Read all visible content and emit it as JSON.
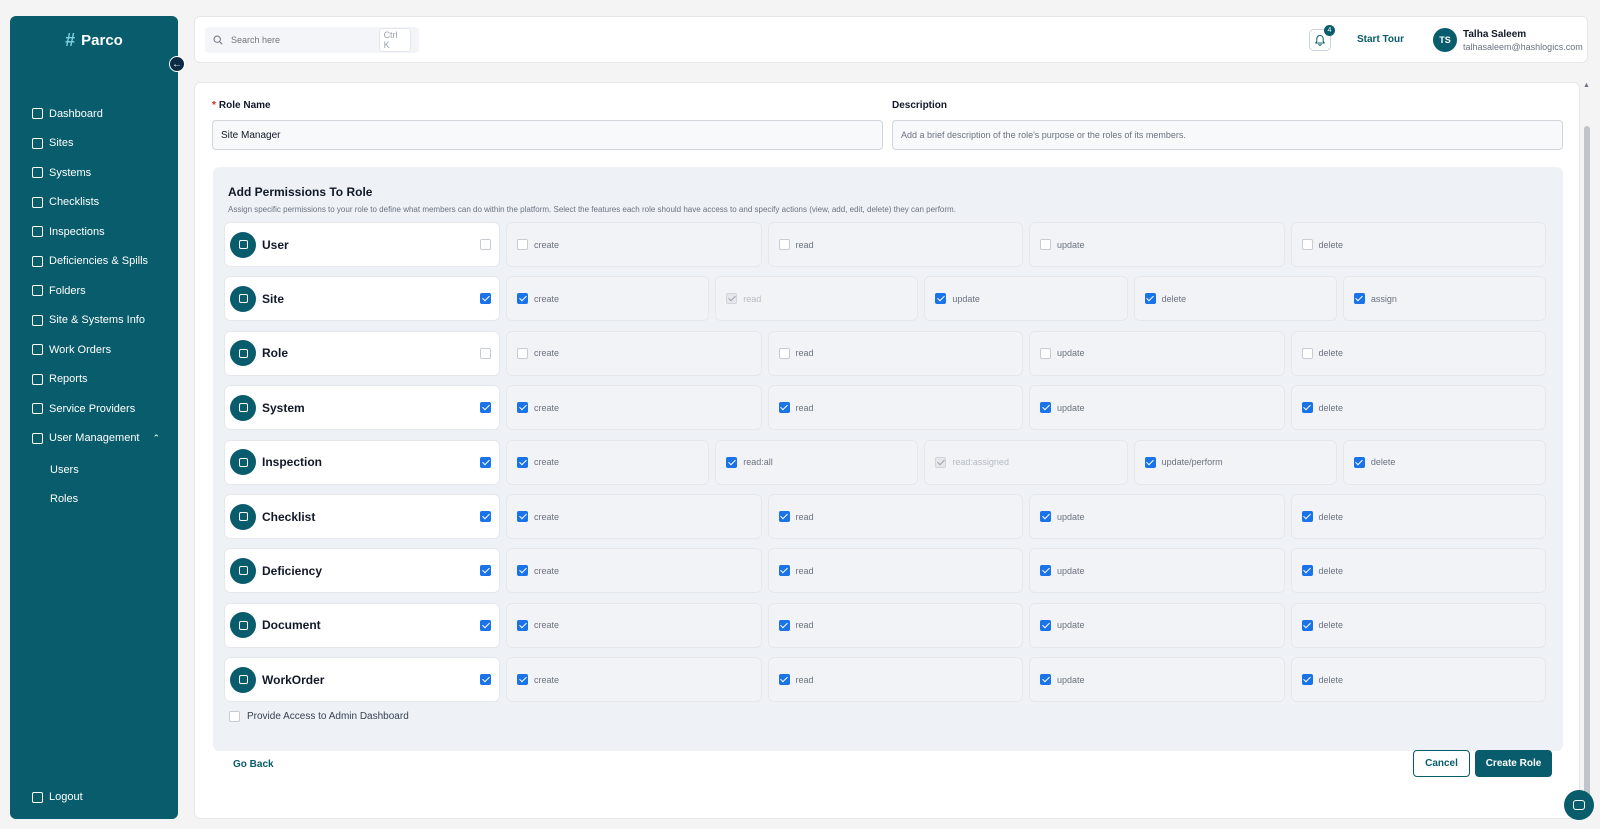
{
  "app": {
    "name": "Parco",
    "logo_glyph": "#"
  },
  "sidebar": {
    "items": [
      {
        "label": "Dashboard",
        "icon": "dashboard-icon"
      },
      {
        "label": "Sites",
        "icon": "building-icon"
      },
      {
        "label": "Systems",
        "icon": "box-icon"
      },
      {
        "label": "Checklists",
        "icon": "checklist-icon"
      },
      {
        "label": "Inspections",
        "icon": "inspection-icon"
      },
      {
        "label": "Deficiencies & Spills",
        "icon": "flag-icon"
      },
      {
        "label": "Folders",
        "icon": "folder-icon"
      },
      {
        "label": "Site & Systems Info",
        "icon": "document-icon"
      },
      {
        "label": "Work Orders",
        "icon": "clipboard-icon"
      },
      {
        "label": "Reports",
        "icon": "report-icon"
      },
      {
        "label": "Service Providers",
        "icon": "provider-icon"
      },
      {
        "label": "User Management",
        "icon": "user-icon",
        "chevron": "⌃"
      }
    ],
    "subitems": [
      {
        "label": "Users"
      },
      {
        "label": "Roles"
      }
    ],
    "logout": "Logout",
    "collapse_glyph": "←"
  },
  "header": {
    "search_placeholder": "Search here",
    "search_shortcut": "Ctrl K",
    "notification_count": "4",
    "start_tour": "Start Tour",
    "user": {
      "initials": "TS",
      "name": "Talha Saleem",
      "email": "talhasaleem@hashlogics.com"
    }
  },
  "form": {
    "role_name_required_mark": "*",
    "role_name_label": "Role Name",
    "role_name_value": "Site Manager",
    "description_label": "Description",
    "description_placeholder": "Add a brief description of the role's purpose or the roles of its members.",
    "permissions_title": "Add Permissions To Role",
    "permissions_subtitle": "Assign specific permissions to your role to define what members can do within the platform. Select the features each role should have access to and specify actions (view, add, edit, delete) they can perform.",
    "admin_access_label": "Provide Access to Admin Dashboard",
    "admin_access_checked": false,
    "go_back": "Go Back",
    "cancel": "Cancel",
    "create_role": "Create Role"
  },
  "permissions": [
    {
      "name": "User",
      "checked": false,
      "actions": [
        {
          "label": "create",
          "state": "off"
        },
        {
          "label": "read",
          "state": "off"
        },
        {
          "label": "update",
          "state": "off"
        },
        {
          "label": "delete",
          "state": "off"
        }
      ]
    },
    {
      "name": "Site",
      "checked": true,
      "actions": [
        {
          "label": "create",
          "state": "on"
        },
        {
          "label": "read",
          "state": "disabled"
        },
        {
          "label": "update",
          "state": "on"
        },
        {
          "label": "delete",
          "state": "on"
        },
        {
          "label": "assign",
          "state": "on"
        }
      ]
    },
    {
      "name": "Role",
      "checked": false,
      "actions": [
        {
          "label": "create",
          "state": "off"
        },
        {
          "label": "read",
          "state": "off"
        },
        {
          "label": "update",
          "state": "off"
        },
        {
          "label": "delete",
          "state": "off"
        }
      ]
    },
    {
      "name": "System",
      "checked": true,
      "actions": [
        {
          "label": "create",
          "state": "on"
        },
        {
          "label": "read",
          "state": "on"
        },
        {
          "label": "update",
          "state": "on"
        },
        {
          "label": "delete",
          "state": "on"
        }
      ]
    },
    {
      "name": "Inspection",
      "checked": true,
      "actions": [
        {
          "label": "create",
          "state": "on"
        },
        {
          "label": "read:all",
          "state": "on"
        },
        {
          "label": "read:assigned",
          "state": "disabled"
        },
        {
          "label": "update/perform",
          "state": "on"
        },
        {
          "label": "delete",
          "state": "on"
        }
      ]
    },
    {
      "name": "Checklist",
      "checked": true,
      "actions": [
        {
          "label": "create",
          "state": "on"
        },
        {
          "label": "read",
          "state": "on"
        },
        {
          "label": "update",
          "state": "on"
        },
        {
          "label": "delete",
          "state": "on"
        }
      ]
    },
    {
      "name": "Deficiency",
      "checked": true,
      "actions": [
        {
          "label": "create",
          "state": "on"
        },
        {
          "label": "read",
          "state": "on"
        },
        {
          "label": "update",
          "state": "on"
        },
        {
          "label": "delete",
          "state": "on"
        }
      ]
    },
    {
      "name": "Document",
      "checked": true,
      "actions": [
        {
          "label": "create",
          "state": "on"
        },
        {
          "label": "read",
          "state": "on"
        },
        {
          "label": "update",
          "state": "on"
        },
        {
          "label": "delete",
          "state": "on"
        }
      ]
    },
    {
      "name": "WorkOrder",
      "checked": true,
      "actions": [
        {
          "label": "create",
          "state": "on"
        },
        {
          "label": "read",
          "state": "on"
        },
        {
          "label": "update",
          "state": "on"
        },
        {
          "label": "delete",
          "state": "on"
        }
      ]
    }
  ],
  "colors": {
    "brand": "#085c6b",
    "checkbox_on": "#1a73e8"
  }
}
